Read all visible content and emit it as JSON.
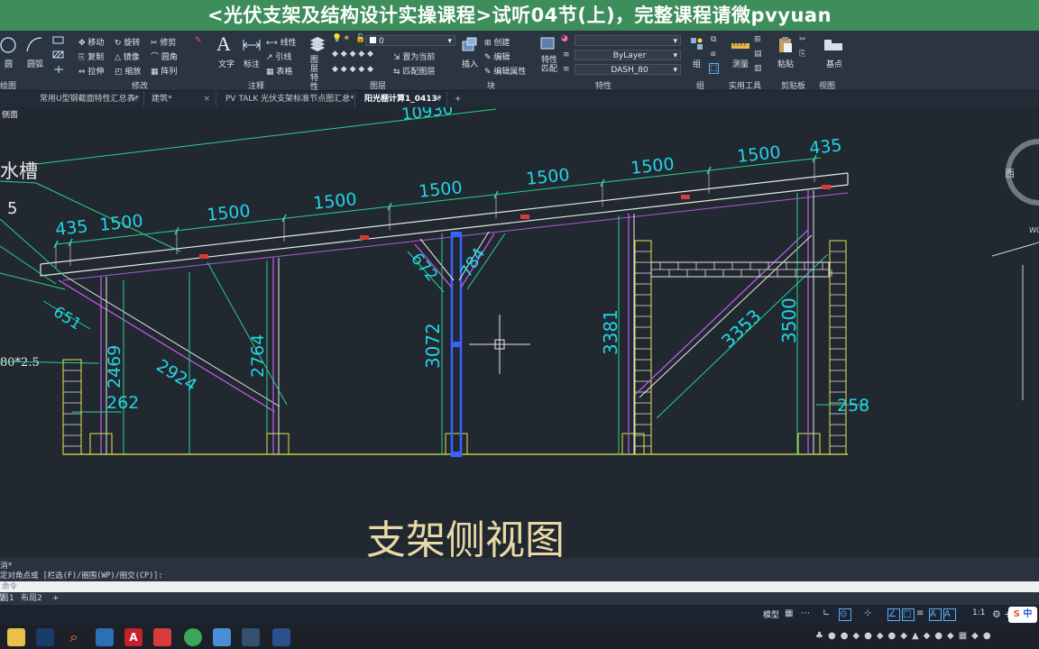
{
  "banner": {
    "text": "<光伏支架及结构设计实操课程>试听04节(上)，完整课程请微pvyuan",
    "color": "#3d8e5a"
  },
  "ribbon": {
    "draw": {
      "circle": "圆",
      "arc": "圆弧",
      "group": "绘图"
    },
    "modify": {
      "move": "移动",
      "rotate": "旋转",
      "trim": "修剪",
      "copy": "复制",
      "mirror": "镜像",
      "fillet": "圆角",
      "stretch": "拉伸",
      "scale": "缩放",
      "array": "阵列",
      "group": "修改"
    },
    "annotation": {
      "text": "文字",
      "dimension": "标注",
      "linear": "线性",
      "leader": "引线",
      "table": "表格",
      "group": "注释"
    },
    "layers": {
      "properties": "图层特性",
      "layer_value": "0",
      "set_current": "置为当前",
      "match_layer": "匹配图层",
      "group": "图层"
    },
    "block": {
      "insert": "插入",
      "create": "创建",
      "edit": "编辑",
      "edit_attr": "编辑属性",
      "group": "块"
    },
    "properties": {
      "match": "特性匹配",
      "lineweight": "ByLayer",
      "linetype": "DASH_80",
      "group": "特性"
    },
    "groups": {
      "group": "组",
      "group_label": "组"
    },
    "utilities": {
      "measure": "测量",
      "group": "实用工具"
    },
    "clipboard": {
      "paste": "粘贴",
      "group": "剪贴板"
    },
    "view": {
      "base": "基点",
      "group": "视图"
    }
  },
  "doc_tabs": [
    {
      "label": "常用U型钢截面特性汇总表*",
      "active": false
    },
    {
      "label": "建筑*",
      "active": false
    },
    {
      "label": "PV TALK 光伏支架标准节点图汇总*",
      "active": false
    },
    {
      "label": "阳光棚计算1_0413*",
      "active": true
    }
  ],
  "tab_close": "×",
  "tab_add": "+",
  "viewport_label": "侧面",
  "drawing": {
    "title": "支架侧视图",
    "total_dim": "10930",
    "top_dims": [
      "435",
      "1500",
      "1500",
      "1500",
      "1500",
      "1500",
      "1500",
      "1500",
      "435"
    ],
    "left_labels": [
      "水槽",
      "5",
      "80*2.5"
    ],
    "diag_dims": [
      "651",
      "2924",
      "672",
      "784",
      "3353"
    ],
    "vert_dims": [
      "2469",
      "2764",
      "3072",
      "3381",
      "3500"
    ],
    "small_dims": [
      "262",
      "258"
    ],
    "viewcube": {
      "west": "西",
      "wcs": "WCS"
    }
  },
  "command": {
    "line1": "消*",
    "line2": "定对角点或 [栏选(F)/圈围(WP)/圈交(CP)]:",
    "placeholder": "命令"
  },
  "layout_tabs": [
    "模型",
    "布局1",
    "布局2"
  ],
  "layout_add": "+",
  "status": {
    "model": "模型",
    "scale": "1:1",
    "ime": "中"
  },
  "colors": {
    "accent": "#3d8e5a",
    "dim": "#22d4e6",
    "dimline": "#2ad28a",
    "purple": "#b05ad6",
    "yellow": "#e7e54a",
    "blue": "#3a62ff",
    "white": "#e8e8e8"
  }
}
